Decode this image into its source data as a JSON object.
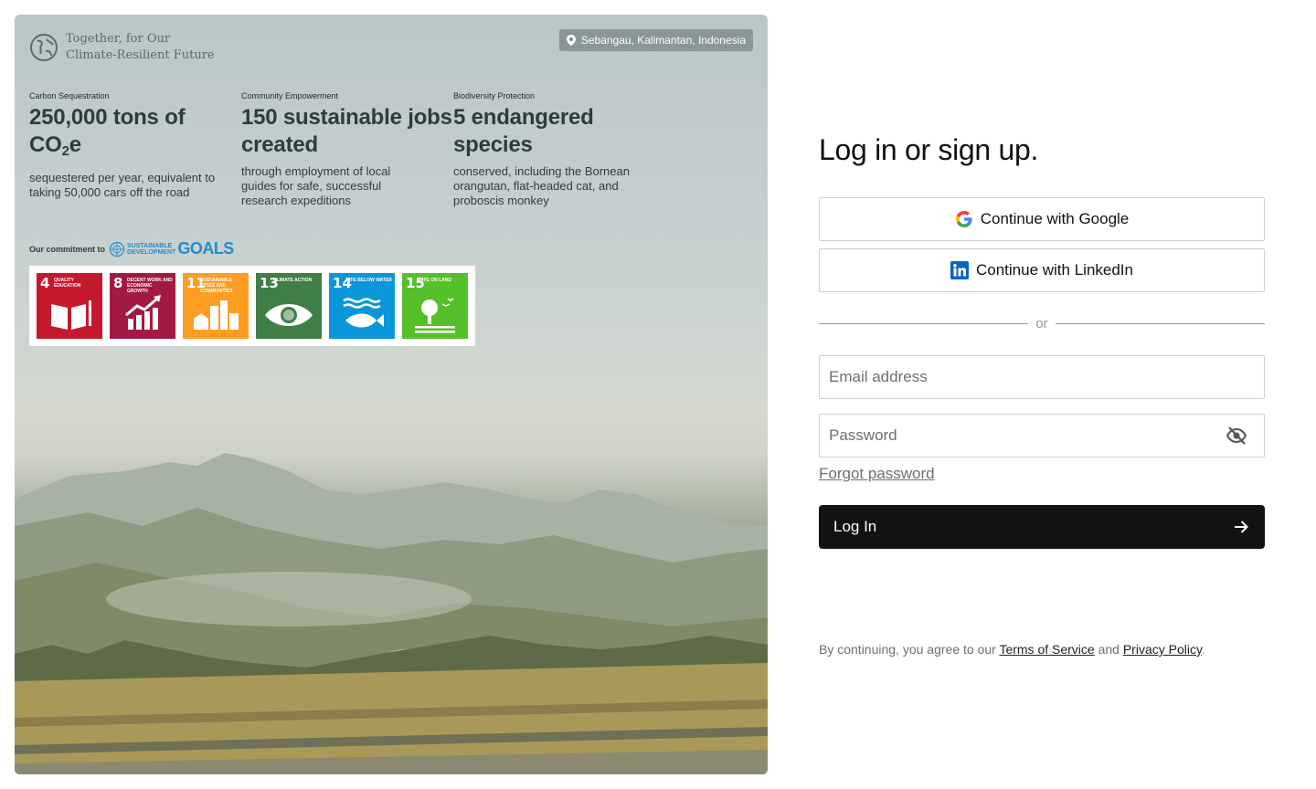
{
  "hero": {
    "brand_line1": "Together, for Our",
    "brand_line2": "Climate-Resilient Future",
    "location": "Sebangau, Kalimantan, Indonesia",
    "stats": [
      {
        "label": "Carbon Sequestration",
        "value_main": "250,000 tons of CO",
        "value_sub": "2",
        "value_tail": "e",
        "description": "sequestered per year, equivalent to taking 50,000 cars off the road"
      },
      {
        "label": "Community Empowerment",
        "value": "150 sustainable jobs created",
        "description": "through employment of local guides for safe, successful research expeditions"
      },
      {
        "label": "Biodiversity Protection",
        "value": "5 endangered species",
        "description": "conserved, including the Bornean orangutan, flat-headed cat, and proboscis monkey"
      }
    ],
    "commitment_label": "Our commitment to",
    "sdg_logo": {
      "line1": "SUSTAINABLE",
      "line2": "DEVELOPMENT",
      "word": "GOALS",
      "color": "#1f8ed0"
    },
    "goals": [
      {
        "number": "4",
        "title": "Quality Education",
        "color": "#c5192d",
        "icon": "book-icon"
      },
      {
        "number": "8",
        "title": "Decent Work and Economic Growth",
        "color": "#a21942",
        "icon": "growth-chart-icon"
      },
      {
        "number": "11",
        "title": "Sustainable Cities and Communities",
        "color": "#fd9d24",
        "icon": "city-icon"
      },
      {
        "number": "13",
        "title": "Climate Action",
        "color": "#3f7e44",
        "icon": "eye-globe-icon"
      },
      {
        "number": "14",
        "title": "Life Below Water",
        "color": "#0a97d9",
        "icon": "fish-icon"
      },
      {
        "number": "15",
        "title": "Life on Land",
        "color": "#56c02b",
        "icon": "tree-icon"
      }
    ]
  },
  "form": {
    "heading": "Log in or sign up.",
    "google_label": "Continue with Google",
    "linkedin_label": "Continue with LinkedIn",
    "divider_text": "or",
    "email_placeholder": "Email address",
    "password_placeholder": "Password",
    "forgot_label": "Forgot password",
    "login_label": "Log In",
    "terms_prefix": "By continuing, you agree to our ",
    "terms_link": "Terms of Service",
    "terms_and": " and ",
    "privacy_link": "Privacy Policy",
    "terms_suffix": "."
  }
}
